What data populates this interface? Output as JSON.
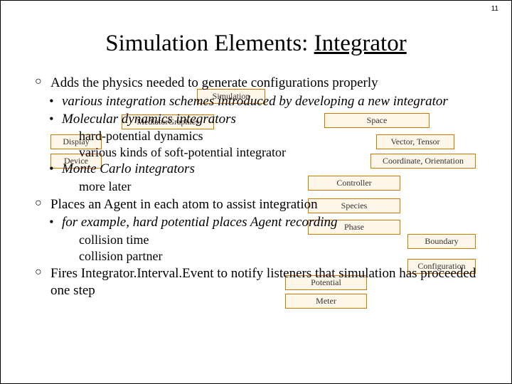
{
  "page_number": "11",
  "title_a": "Simulation Elements:  ",
  "title_b": "Integrator",
  "l1a": "Adds the physics needed to generate configurations properly",
  "l2a": "various integration schemes introduced by developing a new integrator",
  "l2b": "Molecular dynamics integrators",
  "l3a": "hard-potential dynamics",
  "l3b": "various kinds of soft-potential integrator",
  "l2c": "Monte Carlo integrators",
  "l3c": "more later",
  "l1b": "Places an Agent in each atom to assist integration",
  "l2d": "for example, hard potential places Agent recording",
  "l3d": "collision time",
  "l3e": "collision partner",
  "l1c": "Fires Integrator.Interval.Event to notify listeners that simulation has proceeded one step",
  "boxes": {
    "simulation": "Simulation",
    "graphics": "MediatorGraphics",
    "display": "Display",
    "device": "Device",
    "space": "Space",
    "vector": "Vector, Tensor",
    "coord": "Coordinate, Orientation",
    "controller": "Controller",
    "species": "Species",
    "phase": "Phase",
    "boundary": "Boundary",
    "configuration": "Configuration",
    "potential": "Potential",
    "meter": "Meter"
  }
}
